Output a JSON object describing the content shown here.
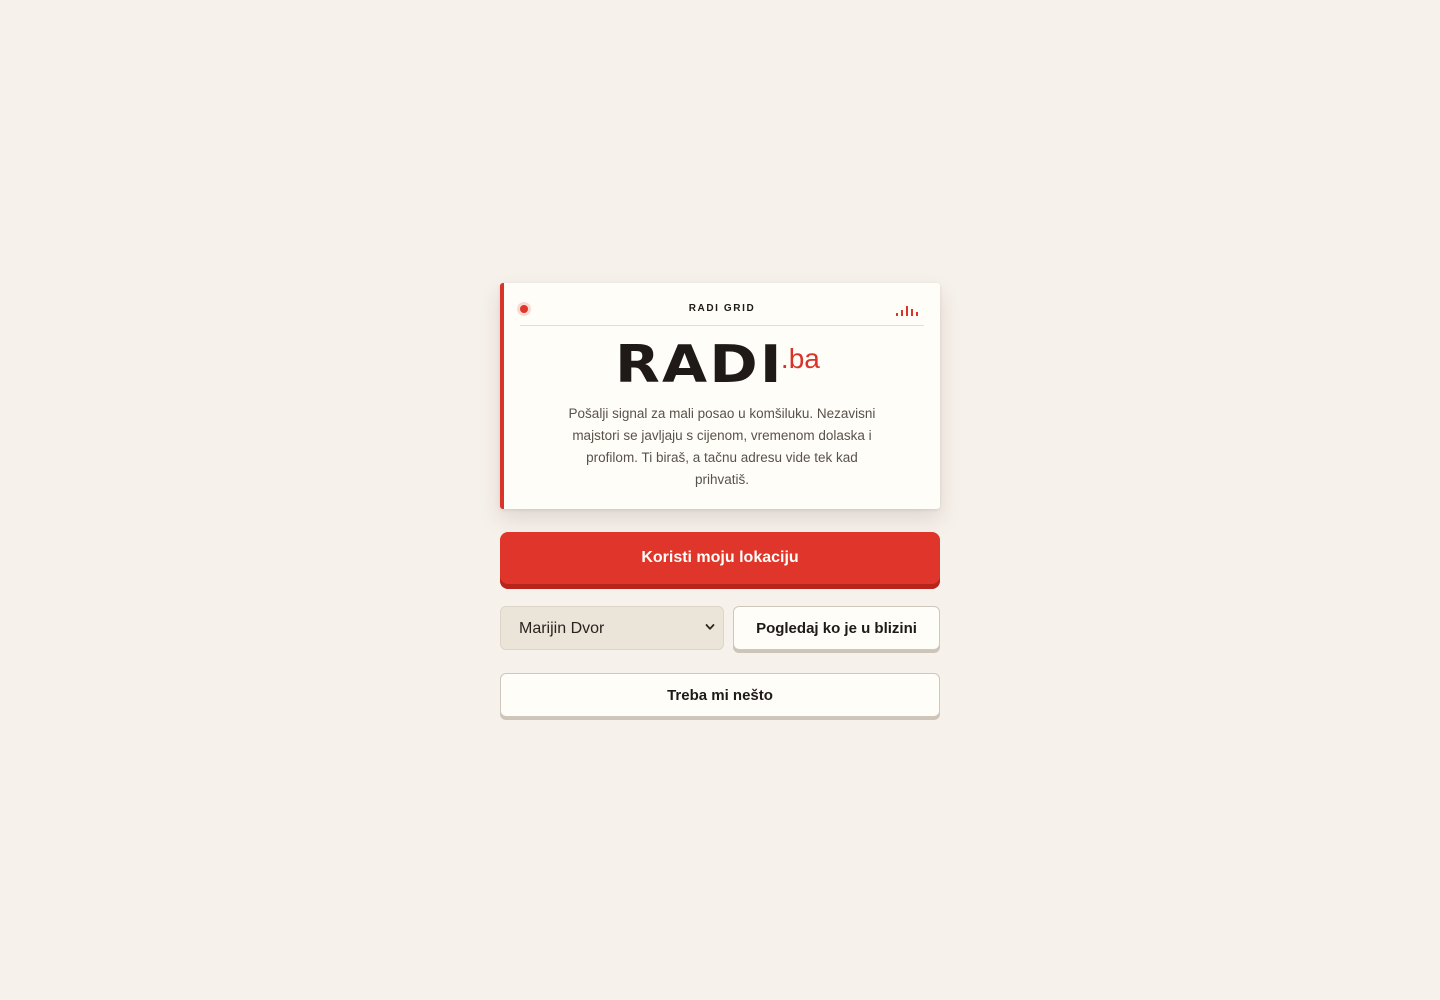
{
  "card": {
    "grid_label": "RADI GRID",
    "logo_main": "RADI",
    "logo_tld": ".ba",
    "description": "Pošalji signal za mali posao u komšiluku. Nezavisni majstori se javljaju s cijenom, vremenom dolaska i profilom. Ti biraš, a tačnu adresu vide tek kad prihvatiš."
  },
  "actions": {
    "use_location_label": "Koristi moju lokaciju",
    "neighborhood_selected": "Marijin Dvor",
    "nearby_label": "Pogledaj ko je u blizini",
    "need_something_label": "Treba mi nešto"
  },
  "icons": {
    "status": "status-dot-icon",
    "signal": "signal-bars-icon",
    "dropdown": "chevron-down-icon"
  },
  "colors": {
    "accent": "#e0352a",
    "background": "#f7f1eb",
    "card": "#fffdf8",
    "text": "#1f1a17"
  }
}
